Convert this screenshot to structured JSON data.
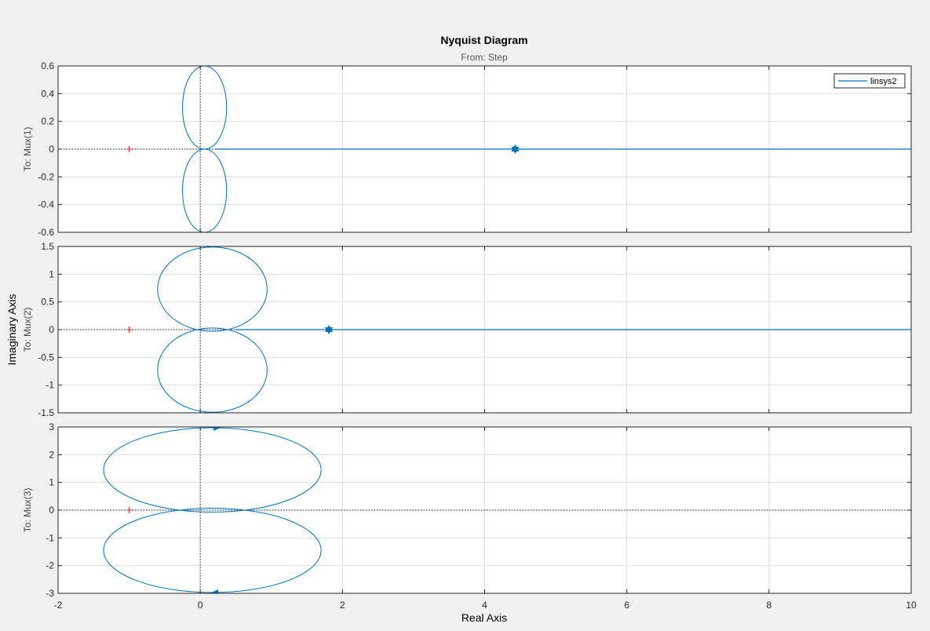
{
  "chart_data": {
    "type": "line",
    "title": "Nyquist Diagram",
    "subtitle": "From: Step",
    "xlabel": "Real Axis",
    "ylabel": "Imaginary Axis",
    "xlim": [
      -2,
      10
    ],
    "xticks": [
      -2,
      0,
      2,
      4,
      6,
      8,
      10
    ],
    "xtick_labels": [
      "-2",
      "0",
      "2",
      "4",
      "6",
      "8",
      "10"
    ],
    "grid": true,
    "legend": {
      "location": "top-right",
      "entries": [
        "linsys2"
      ]
    },
    "line_color": "#0072bd",
    "critical_point": {
      "x": -1,
      "y": 0,
      "color": "#e02020"
    },
    "panels": [
      {
        "ylabel": "To: Mux(1)",
        "ylim": [
          -0.6,
          0.6
        ],
        "yticks": [
          0.6,
          0.4,
          0.2,
          0,
          -0.2,
          -0.4,
          -0.6
        ],
        "ytick_labels": [
          "0.6",
          "0.4",
          "0.2",
          "0",
          "-0.2",
          "-0.4",
          "-0.6"
        ],
        "loops": [
          {
            "cx": 0.06,
            "cy": 0.3,
            "rx": 0.31,
            "ry": 0.3
          },
          {
            "cx": 0.06,
            "cy": -0.3,
            "rx": 0.31,
            "ry": 0.3
          }
        ],
        "tail": {
          "x0": 0.22,
          "x1": 10
        },
        "marker": {
          "x": 4.43,
          "y": 0
        }
      },
      {
        "ylabel": "To: Mux(2)",
        "ylim": [
          -1.5,
          1.5
        ],
        "yticks": [
          1.5,
          1,
          0.5,
          0,
          -0.5,
          -1,
          -1.5
        ],
        "ytick_labels": [
          "1.5",
          "1",
          "0.5",
          "0",
          "-0.5",
          "-1",
          "-1.5"
        ],
        "loops": [
          {
            "cx": 0.17,
            "cy": 0.73,
            "rx": 0.77,
            "ry": 0.76
          },
          {
            "cx": 0.17,
            "cy": -0.73,
            "rx": 0.77,
            "ry": 0.76
          }
        ],
        "tail": {
          "x0": 0.5,
          "x1": 10
        },
        "marker": {
          "x": 1.81,
          "y": 0
        }
      },
      {
        "ylabel": "To: Mux(3)",
        "ylim": [
          -3,
          3
        ],
        "yticks": [
          3,
          2,
          1,
          0,
          -1,
          -2,
          -3
        ],
        "ytick_labels": [
          "3",
          "2",
          "1",
          "0",
          "-1",
          "-2",
          "-3"
        ],
        "loops": [
          {
            "cx": 0.17,
            "cy": 1.45,
            "rx": 1.53,
            "ry": 1.52
          },
          {
            "cx": 0.17,
            "cy": -1.45,
            "rx": 1.53,
            "ry": 1.52
          }
        ],
        "tail": null,
        "marker": null,
        "arrows": [
          {
            "x": 0.22,
            "y": 2.97,
            "dir": "right"
          },
          {
            "x": 0.22,
            "y": -2.97,
            "dir": "left"
          }
        ]
      }
    ]
  }
}
